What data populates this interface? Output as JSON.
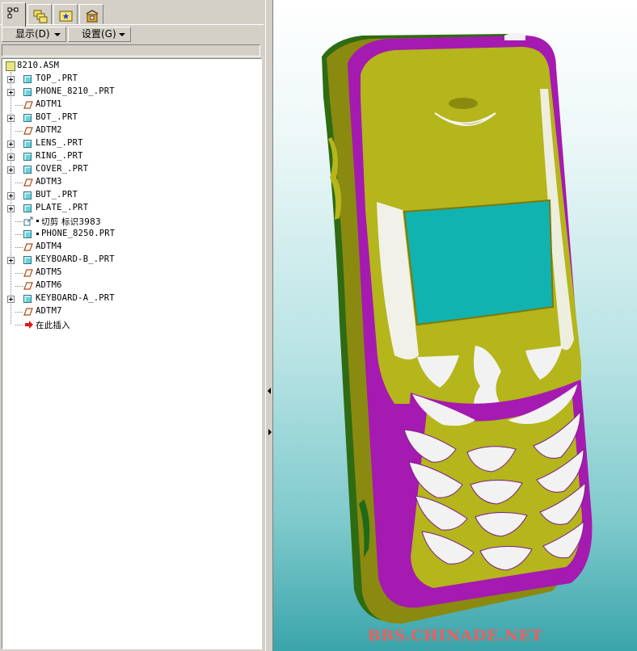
{
  "menubar": {
    "display_label": "显示(D)",
    "settings_label": "设置(G)"
  },
  "tree": {
    "root": "8210.ASM",
    "items": [
      {
        "label": "TOP_.PRT",
        "type": "part",
        "expandable": true
      },
      {
        "label": "PHONE_8210_.PRT",
        "type": "part",
        "expandable": true
      },
      {
        "label": "ADTM1",
        "type": "datum",
        "expandable": false
      },
      {
        "label": "BOT_.PRT",
        "type": "part",
        "expandable": true
      },
      {
        "label": "ADTM2",
        "type": "datum",
        "expandable": false
      },
      {
        "label": "LENS_.PRT",
        "type": "part",
        "expandable": true
      },
      {
        "label": "RING_.PRT",
        "type": "part",
        "expandable": true
      },
      {
        "label": "COVER_.PRT",
        "type": "part",
        "expandable": true
      },
      {
        "label": "ADTM3",
        "type": "datum",
        "expandable": false
      },
      {
        "label": "BUT_.PRT",
        "type": "part",
        "expandable": true
      },
      {
        "label": "PLATE_.PRT",
        "type": "part",
        "expandable": true
      },
      {
        "label": "切剪 标识3983",
        "type": "cut",
        "expandable": false
      },
      {
        "label": "PHONE_8250.PRT",
        "type": "part-marked",
        "expandable": false
      },
      {
        "label": "ADTM4",
        "type": "datum",
        "expandable": false
      },
      {
        "label": "KEYBOARD-B_.PRT",
        "type": "part",
        "expandable": true
      },
      {
        "label": "ADTM5",
        "type": "datum",
        "expandable": false
      },
      {
        "label": "ADTM6",
        "type": "datum",
        "expandable": false
      },
      {
        "label": "KEYBOARD-A_.PRT",
        "type": "part",
        "expandable": true
      },
      {
        "label": "ADTM7",
        "type": "datum",
        "expandable": false
      },
      {
        "label": "在此插入",
        "type": "insert",
        "expandable": false
      }
    ]
  },
  "viewport": {
    "watermark": "BBS.CHINADE.NET",
    "colors": {
      "body": "#b5b51c",
      "frame": "#b21eb8",
      "screen": "#11b3b1",
      "keys": "#f2f2f2"
    }
  }
}
